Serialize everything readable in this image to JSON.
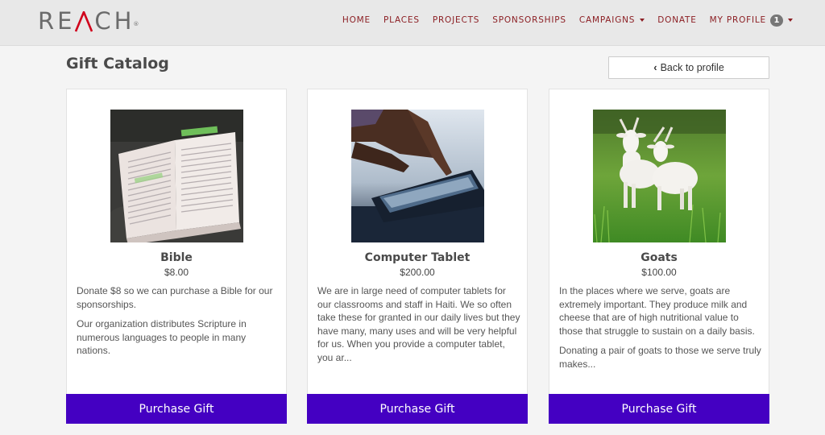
{
  "header": {
    "logo_text_before": "RE",
    "logo_text_accent": "A",
    "logo_text_after": "CH",
    "logo_reg": "®",
    "nav": [
      {
        "label": "HOME"
      },
      {
        "label": "PLACES"
      },
      {
        "label": "PROJECTS"
      },
      {
        "label": "SPONSORSHIPS"
      },
      {
        "label": "CAMPAIGNS"
      },
      {
        "label": "DONATE"
      },
      {
        "label": "MY PROFILE"
      }
    ],
    "profile_badge": "1"
  },
  "page": {
    "title": "Gift Catalog",
    "back_label": "Back to profile"
  },
  "gifts": [
    {
      "name": "Bible",
      "price": "$8.00",
      "desc": [
        "Donate $8 so we can purchase a Bible for our sponsorships.",
        "Our organization distributes Scripture in numerous languages to people in many nations."
      ],
      "button": "Purchase Gift"
    },
    {
      "name": "Computer Tablet",
      "price": "$200.00",
      "desc": [
        "We are in large need of computer tablets for our classrooms and staff in Haiti. We so often take these for granted in our daily lives but they have many, many uses and will be very helpful for us. When you provide a computer tablet, you ar..."
      ],
      "button": "Purchase Gift"
    },
    {
      "name": "Goats",
      "price": "$100.00",
      "desc": [
        "In the places where we serve, goats are extremely important. They produce milk and cheese that are of high nutritional value to those that struggle to sustain on a daily basis.",
        "Donating a pair of goats to those we serve truly makes..."
      ],
      "button": "Purchase Gift"
    }
  ],
  "colors": {
    "brand_red": "#8c1f24",
    "button_purple": "#4400c2",
    "logo_gray": "#6b6b6b"
  }
}
